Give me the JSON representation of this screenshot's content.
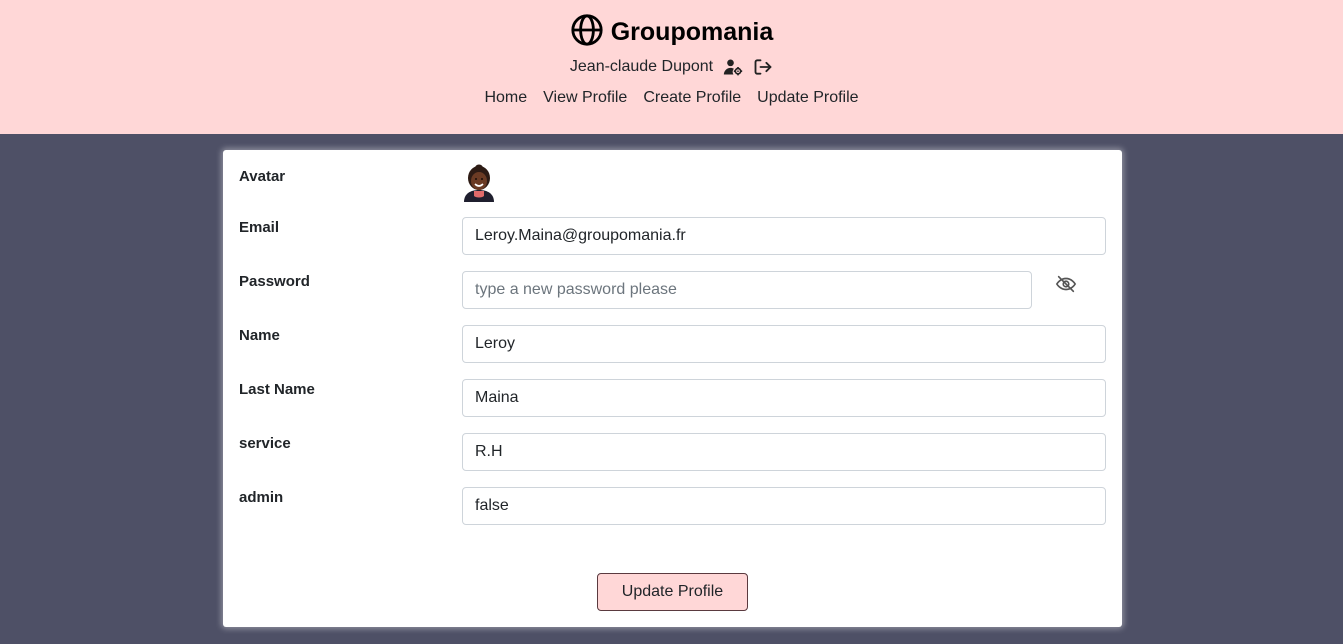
{
  "header": {
    "brand": "Groupomania",
    "user_name": "Jean-claude Dupont",
    "icons": [
      "globe-icon",
      "user-gear-icon",
      "logout-icon"
    ],
    "bg_color": "#ffd7d7"
  },
  "nav": {
    "home": "Home",
    "view_profile": "View Profile",
    "create_profile": "Create Profile",
    "update_profile": "Update Profile"
  },
  "form": {
    "avatar_label": "Avatar",
    "email_label": "Email",
    "email_value": "Leroy.Maina@groupomania.fr",
    "password_label": "Password",
    "password_placeholder": "type a new password please",
    "name_label": "Name",
    "name_value": "Leroy",
    "lastname_label": "Last Name",
    "lastname_value": "Maina",
    "service_label": "service",
    "service_value": "R.H",
    "admin_label": "admin",
    "admin_value": "false",
    "submit_label": "Update Profile"
  },
  "colors": {
    "page_bg": "#4e5066",
    "button_bg": "#ffd7d7"
  }
}
